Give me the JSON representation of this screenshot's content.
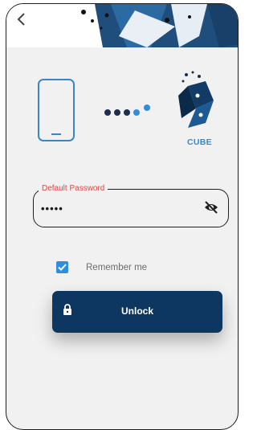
{
  "header": {
    "back_icon": "chevron-left-icon"
  },
  "devices": {
    "phone_icon": "smartphone-icon",
    "progress_icon": "connecting-dots-icon",
    "logo_label": "CUBE"
  },
  "password_field": {
    "label": "Default Password",
    "value": "•••••",
    "visibility_icon": "eye-off-icon"
  },
  "remember_me": {
    "label": "Remember me",
    "checked": true
  },
  "unlock_button": {
    "label": "Unlock",
    "icon": "lock-icon"
  },
  "colors": {
    "primary": "#0d3660",
    "accent": "#2f8de0",
    "error": "#e0463f",
    "background": "#f1f1f1"
  }
}
